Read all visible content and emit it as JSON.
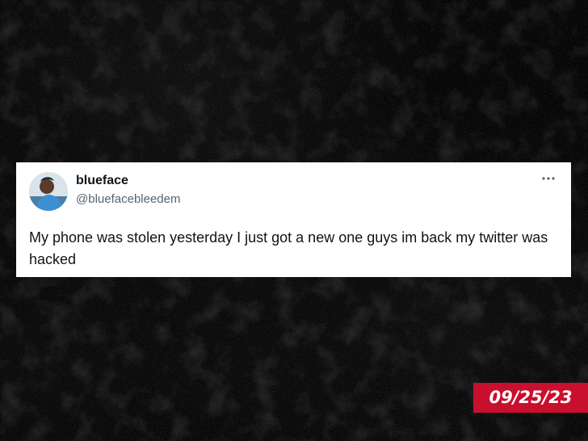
{
  "tweet": {
    "display_name": "blueface",
    "handle": "@bluefacebleedem",
    "text": "My phone was stolen yesterday I just got a new one guys im back my twitter was hacked",
    "more_icon": "more-horizontal-icon",
    "avatar_icon": "profile-avatar"
  },
  "badge": {
    "date": "09/25/23",
    "color": "#c8102e"
  },
  "theme": {
    "background": "#070707",
    "card_background": "#ffffff",
    "name_color": "#0f1419",
    "handle_color": "#536471"
  }
}
